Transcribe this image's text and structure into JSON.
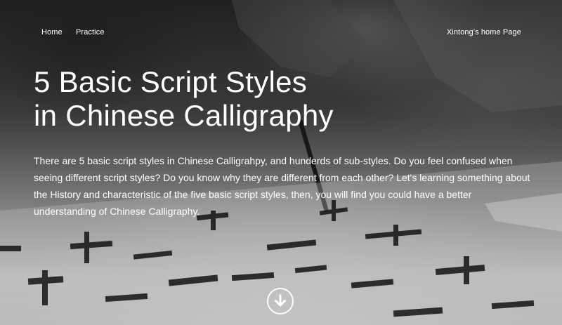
{
  "nav": {
    "home": "Home",
    "practice": "Practice",
    "owner_link": "Xintong's home Page"
  },
  "hero": {
    "title_line1": "5 Basic Script Styles",
    "title_line2": "in Chinese Calligraphy",
    "intro": "There are 5 basic script styles in Chinese Calligrahpy, and hunderds of sub-styles. Do you feel confused when seeing different script styles? Do you know why they are different from each other? Let's learning something about the History and characteristic of the five basic script styles, then, you will find you could have a better understanding of Chinese Calligraphy.",
    "scroll_icon": "arrow-down-circle-icon"
  }
}
